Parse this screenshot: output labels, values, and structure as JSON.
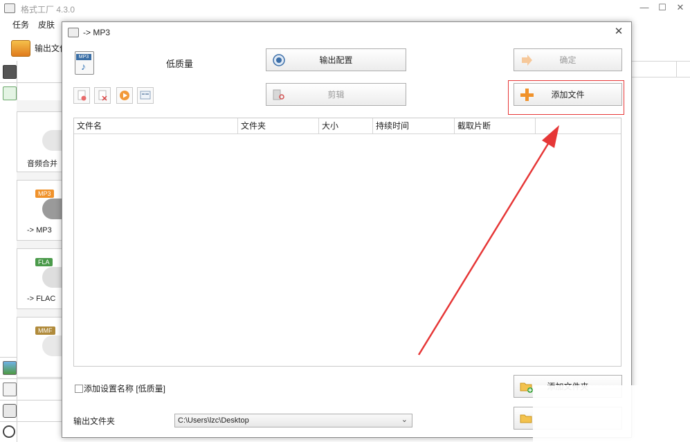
{
  "main_window": {
    "title": "格式工厂 4.3.0",
    "menu": [
      "任务",
      "皮肤"
    ],
    "toolbar_label": "输出文件",
    "cards": [
      {
        "label": "音频合并",
        "badge": ""
      },
      {
        "label": "-> MP3",
        "badge": "MP3"
      },
      {
        "label": "-> FLAC",
        "badge": "FLA"
      },
      {
        "label": "",
        "badge": "MMF"
      }
    ]
  },
  "dialog": {
    "title": "-> MP3",
    "format_badge": "MP3",
    "quality_label": "低质量",
    "output_config_button": "输出配置",
    "edit_button": "剪辑",
    "ok_button": "确定",
    "add_file_button": "添加文件",
    "add_folder_button": "添加文件夹",
    "table_columns": [
      "文件名",
      "文件夹",
      "大小",
      "持续时间",
      "截取片断"
    ],
    "checkbox_label": "添加设置名称 [低质量]",
    "output_folder_label": "输出文件夹",
    "output_folder_path": "C:\\Users\\lzc\\Desktop"
  },
  "colors": {
    "highlight": "#e63737",
    "arrow": "#e63737",
    "accent_orange": "#f0922b"
  }
}
